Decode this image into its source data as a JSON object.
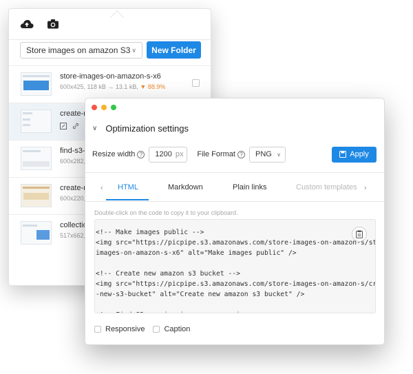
{
  "panel": {
    "folder_select_value": "Store images on amazon S3",
    "new_folder_label": "New Folder",
    "upload_icon": "cloud-upload-icon",
    "camera_icon": "camera-icon",
    "items": [
      {
        "name": "store-images-on-amazon-s-x6",
        "size": "600x425, 118 kB → 13.1 kB,",
        "savings": "▼ 88.9%"
      },
      {
        "name": "create-n",
        "size": ""
      },
      {
        "name": "find-s3-",
        "size": "600x282,"
      },
      {
        "name": "create-n",
        "size": "600x220,"
      },
      {
        "name": "collection",
        "size": "517x662,"
      }
    ]
  },
  "window": {
    "title": "Optimization settings",
    "resize_label": "Resize width",
    "width_value": "1200",
    "width_unit": "px",
    "format_label": "File Format",
    "format_value": "PNG",
    "apply_label": "Apply",
    "tabs": [
      "HTML",
      "Markdown",
      "Plain links",
      "Custom templates"
    ],
    "active_tab": "HTML",
    "hint": "Double-click on the code to copy it to your clipboard.",
    "code": "<!-- Make images public -->\n<img src=\"https://picpipe.s3.amazonaws.com/store-images-on-amazon-s/store-\nimages-on-amazon-s-x6\" alt=\"Make images public\" />\n\n<!-- Create new amazon s3 bucket -->\n<img src=\"https://picpipe.s3.amazonaws.com/store-images-on-amazon-s/create\n-new-s3-bucket\" alt=\"Create new amazon s3 bucket\" />\n\n<!-- Find S3 service in amazon services -->",
    "checkboxes": [
      "Responsive",
      "Caption"
    ]
  },
  "colors": {
    "accent": "#1e88e5",
    "savings": "#f0882b"
  }
}
